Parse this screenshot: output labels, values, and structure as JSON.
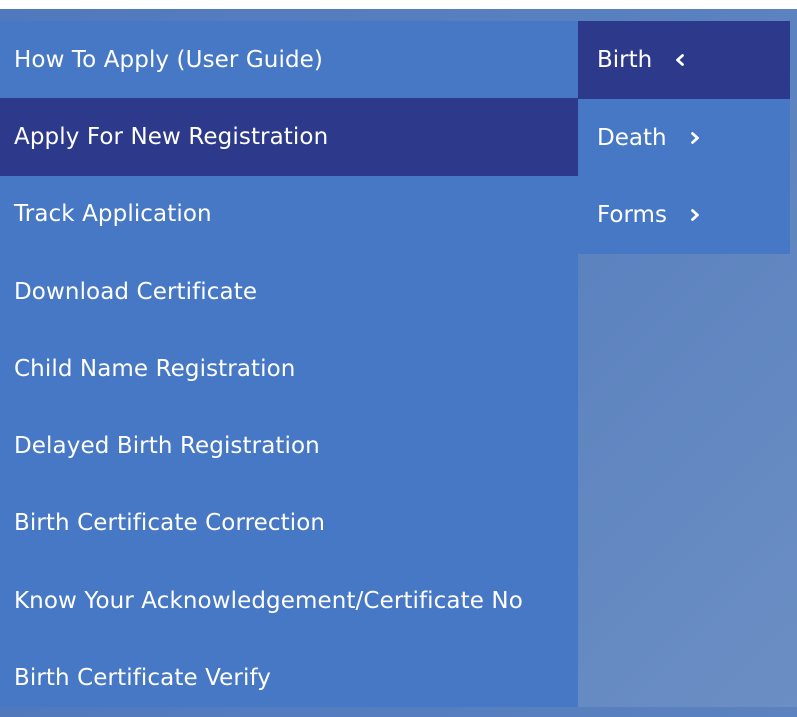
{
  "submenu": {
    "items": [
      {
        "label": "How To Apply (User Guide)"
      },
      {
        "label": "Apply For New Registration"
      },
      {
        "label": "Track Application"
      },
      {
        "label": "Download Certificate"
      },
      {
        "label": "Child Name Registration"
      },
      {
        "label": "Delayed Birth Registration"
      },
      {
        "label": "Birth Certificate Correction"
      },
      {
        "label": "Know Your Acknowledgement/Certificate No"
      },
      {
        "label": "Birth Certificate Verify"
      }
    ],
    "active_index": 1
  },
  "mainmenu": {
    "items": [
      {
        "label": "Birth",
        "icon": "chevron-left-icon"
      },
      {
        "label": "Death",
        "icon": "chevron-right-icon"
      },
      {
        "label": "Forms",
        "icon": "chevron-right-icon"
      }
    ],
    "active_index": 0
  },
  "colors": {
    "menu_bg": "#4778c5",
    "active_bg": "#2d3a8c",
    "text": "#ffffff"
  }
}
